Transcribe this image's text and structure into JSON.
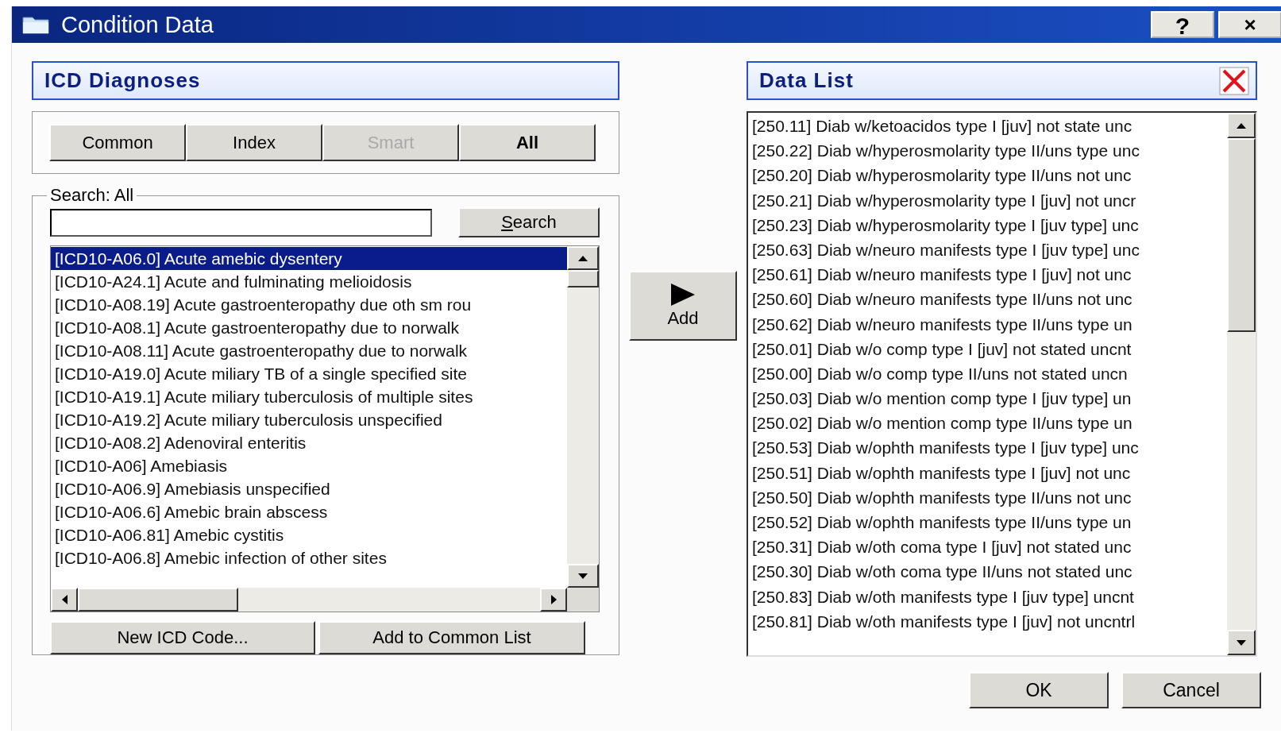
{
  "window": {
    "title": "Condition Data",
    "buttons": [
      {
        "kind": "help",
        "label": "?"
      },
      {
        "kind": "close",
        "label": "×"
      }
    ]
  },
  "icd_panel": {
    "title": "ICD Diagnoses",
    "filter_buttons": [
      {
        "label": "Common",
        "selected": false,
        "disabled": false
      },
      {
        "label": "Index",
        "selected": false,
        "disabled": false
      },
      {
        "label": "Smart",
        "selected": false,
        "disabled": true
      },
      {
        "label": "All",
        "selected": true,
        "disabled": false
      }
    ],
    "search": {
      "group_label": "Search: All",
      "button": "Search"
    },
    "results": [
      {
        "text": "[ICD10-A06.0] Acute amebic dysentery",
        "selected": true
      },
      {
        "text": "[ICD10-A24.1] Acute and fulminating melioidosis",
        "selected": false
      },
      {
        "text": "[ICD10-A08.19] Acute gastroenteropathy due oth sm rou",
        "selected": false
      },
      {
        "text": "[ICD10-A08.1] Acute gastroenteropathy due to norwalk",
        "selected": false
      },
      {
        "text": "[ICD10-A08.11] Acute gastroenteropathy due to norwalk",
        "selected": false
      },
      {
        "text": "[ICD10-A19.0] Acute miliary TB of a single specified site",
        "selected": false
      },
      {
        "text": "[ICD10-A19.1] Acute miliary tuberculosis of multiple sites",
        "selected": false
      },
      {
        "text": "[ICD10-A19.2] Acute miliary tuberculosis unspecified",
        "selected": false
      },
      {
        "text": "[ICD10-A08.2] Adenoviral enteritis",
        "selected": false
      },
      {
        "text": "[ICD10-A06] Amebiasis",
        "selected": false
      },
      {
        "text": "[ICD10-A06.9] Amebiasis unspecified",
        "selected": false
      },
      {
        "text": "[ICD10-A06.6] Amebic brain abscess",
        "selected": false
      },
      {
        "text": "[ICD10-A06.81] Amebic cystitis",
        "selected": false
      },
      {
        "text": "[ICD10-A06.8] Amebic infection of other sites",
        "selected": false
      }
    ],
    "bottom_buttons": [
      "New ICD Code...",
      "Add to Common List"
    ]
  },
  "add_button": "Add",
  "data_list": {
    "title": "Data List",
    "items": [
      "[250.11] Diab w/ketoacidos type I [juv] not state unc",
      "[250.22] Diab w/hyperosmolarity type II/uns type unc",
      "[250.20] Diab w/hyperosmolarity type II/uns not unc",
      "[250.21] Diab w/hyperosmolarity type I [juv] not uncr",
      "[250.23] Diab w/hyperosmolarity type I [juv type] unc",
      "[250.63] Diab w/neuro manifests type I [juv type] unc",
      "[250.61] Diab w/neuro manifests type I [juv] not unc",
      "[250.60] Diab w/neuro manifests type II/uns not unc",
      "[250.62] Diab w/neuro manifests type II/uns type un",
      "[250.01] Diab w/o comp type I [juv] not stated uncnt",
      "[250.00] Diab w/o comp type II/uns not stated uncn",
      "[250.03] Diab w/o mention comp type I [juv type] un",
      "[250.02] Diab w/o mention comp type II/uns type un",
      "[250.53] Diab w/ophth manifests type I [juv type] unc",
      "[250.51] Diab w/ophth manifests type I [juv] not unc",
      "[250.50] Diab w/ophth manifests type II/uns not unc",
      "[250.52] Diab w/ophth manifests type II/uns type un",
      "[250.31] Diab w/oth coma type I [juv] not stated unc",
      "[250.30] Diab w/oth coma type II/uns not stated unc",
      "[250.83] Diab w/oth manifests type I [juv type] uncnt",
      "[250.81] Diab w/oth manifests type I [juv] not uncntrl"
    ]
  },
  "dialog_buttons": [
    "OK",
    "Cancel"
  ]
}
